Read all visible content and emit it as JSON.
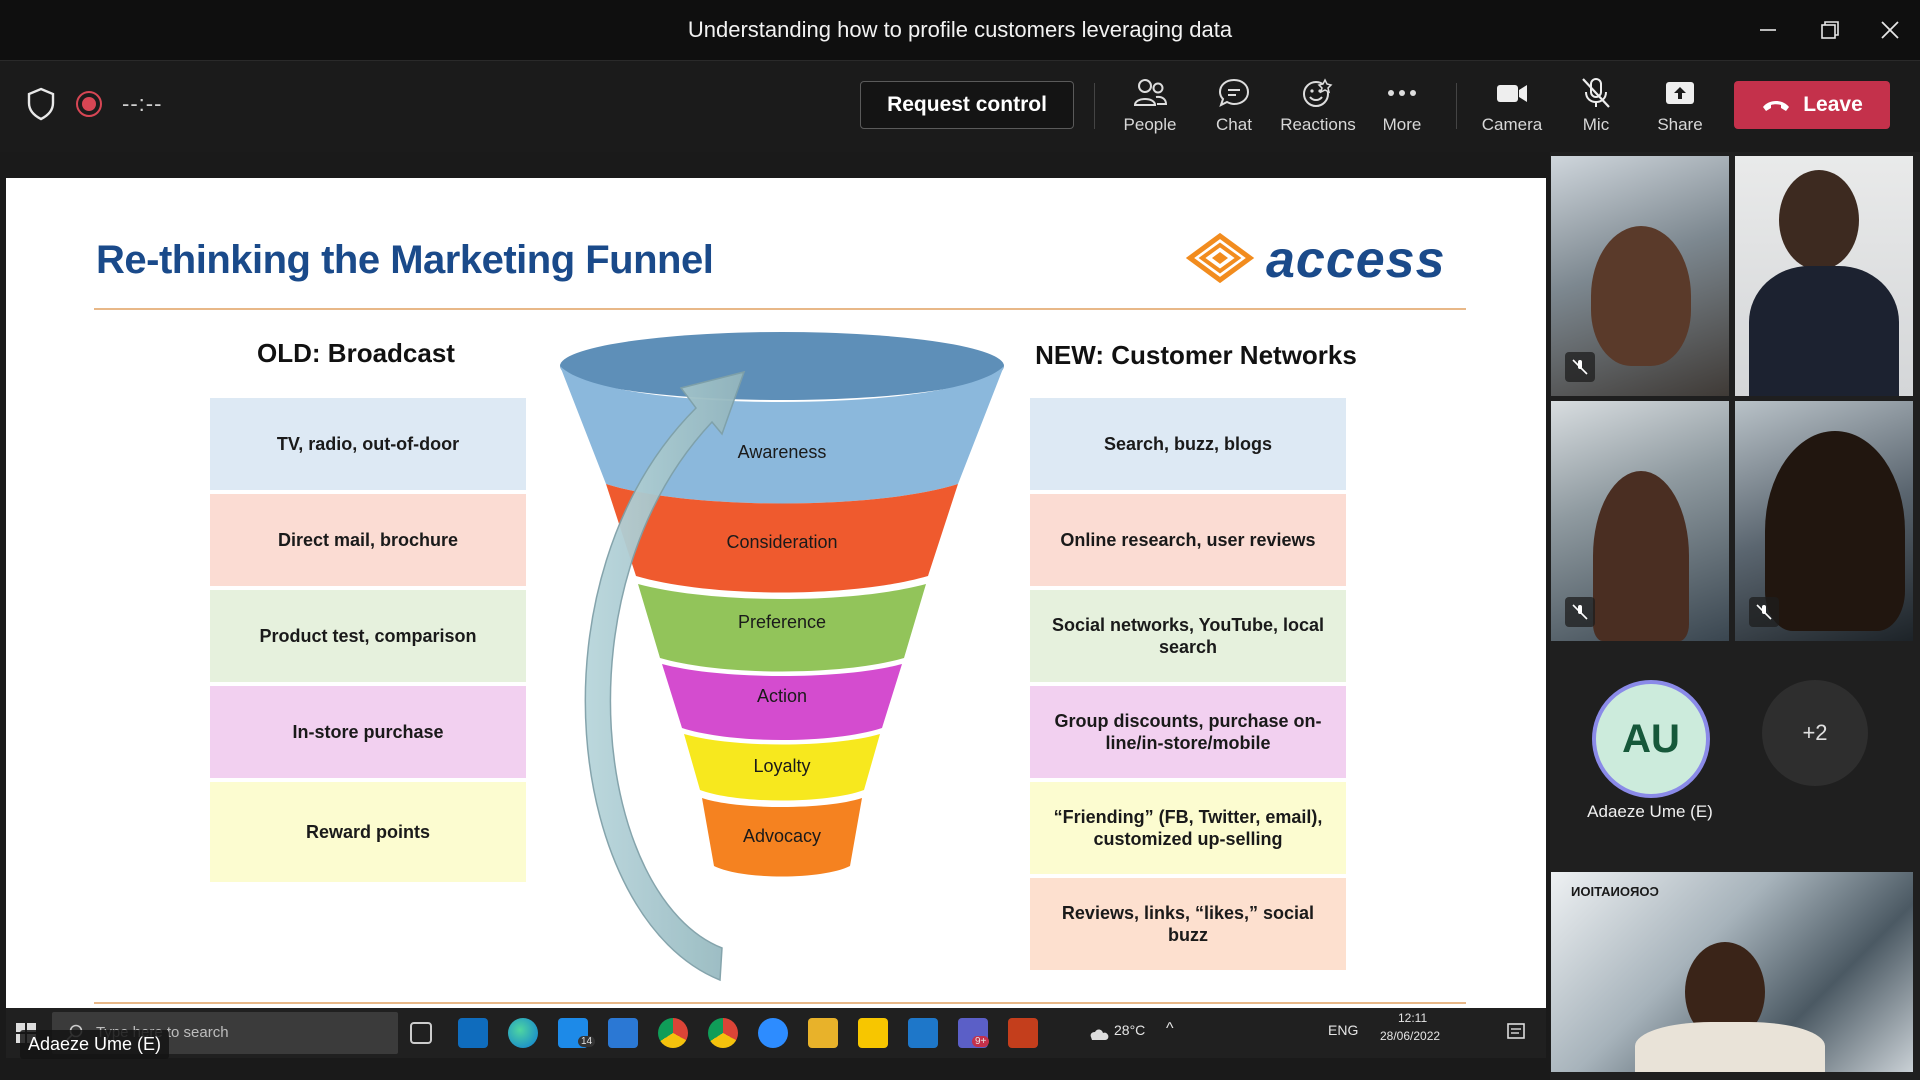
{
  "window": {
    "title": "Understanding how to profile customers leveraging data",
    "controls": [
      "minimize",
      "restore",
      "close"
    ]
  },
  "toolbar": {
    "timer": "--:--",
    "request_control_label": "Request control",
    "items": [
      {
        "label": "People",
        "icon": "people-icon"
      },
      {
        "label": "Chat",
        "icon": "chat-icon"
      },
      {
        "label": "Reactions",
        "icon": "reactions-icon"
      },
      {
        "label": "More",
        "icon": "more-icon"
      },
      {
        "label": "Camera",
        "icon": "camera-icon"
      },
      {
        "label": "Mic",
        "icon": "mic-off-icon"
      },
      {
        "label": "Share",
        "icon": "share-icon"
      }
    ],
    "leave_label": "Leave",
    "colors": {
      "leave": "#c4314b",
      "recording": "#d74654"
    }
  },
  "slide": {
    "title": "Re-thinking the Marketing Funnel",
    "logo_text": "access",
    "old_heading": "OLD: Broadcast",
    "new_heading": "NEW: Customer Networks",
    "old_items": [
      "TV, radio, out-of-door",
      "Direct mail, brochure",
      "Product test, comparison",
      "In-store purchase",
      "Reward points"
    ],
    "new_items": [
      "Search, buzz, blogs",
      "Online research, user reviews",
      "Social networks, YouTube, local search",
      "Group discounts, purchase on-line/in-store/mobile",
      "“Friending” (FB, Twitter, email), customized up-selling",
      "Reviews, links, “likes,” social buzz"
    ],
    "funnel_stages": [
      "Awareness",
      "Consideration",
      "Preference",
      "Action",
      "Loyalty",
      "Advocacy"
    ],
    "colors": {
      "title": "#1a4a8a",
      "awareness": "#8bb8dc",
      "consideration": "#ef5a2e",
      "preference": "#92c45a",
      "action": "#d44ccf",
      "loyalty": "#f7e81e",
      "advocacy": "#f58220"
    }
  },
  "participants": {
    "avatar_initials": "AU",
    "avatar_name": "Adaeze Ume (E)",
    "overflow": "+2",
    "video_sign_text": "CORONATION"
  },
  "taskbar": {
    "search_placeholder": "Type here to search",
    "presenter_tag": "Adaeze Ume (E)",
    "weather": "28°C",
    "language": "ENG",
    "time": "12:11",
    "date": "28/06/2022",
    "mail_badge": "14",
    "teams_badge": "9+"
  }
}
